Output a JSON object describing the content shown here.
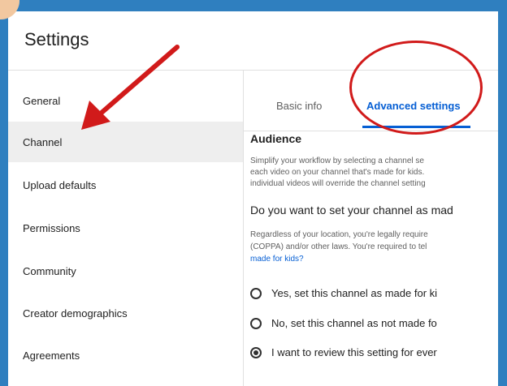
{
  "window": {
    "title": "Settings"
  },
  "sidebar": {
    "items": [
      {
        "label": "General"
      },
      {
        "label": "Channel",
        "active": true
      },
      {
        "label": "Upload defaults"
      },
      {
        "label": "Permissions"
      },
      {
        "label": "Community"
      },
      {
        "label": "Creator demographics"
      },
      {
        "label": "Agreements"
      }
    ]
  },
  "tabs": {
    "basic": "Basic info",
    "advanced": "Advanced settings",
    "selected": "advanced"
  },
  "content": {
    "audience_heading": "Audience",
    "audience_lines": [
      "Simplify your workflow by selecting a channel se",
      "each video on your channel that's made for kids.",
      "individual videos will override the channel setting"
    ],
    "question": "Do you want to set your channel as mad",
    "legal_lines": [
      "Regardless of your location, you're legally require",
      "(COPPA) and/or other laws. You're required to tel"
    ],
    "link": "made for kids?",
    "options": [
      {
        "label": "Yes, set this channel as made for ki",
        "checked": false
      },
      {
        "label": "No, set this channel as not made fo",
        "checked": false
      },
      {
        "label": "I want to review this setting for ever",
        "checked": true
      }
    ]
  },
  "annotations": {
    "color": "#d11a1a"
  },
  "colors": {
    "background": "#2f7fbf",
    "accent": "#065fd4",
    "active_row": "#eeeeee"
  }
}
